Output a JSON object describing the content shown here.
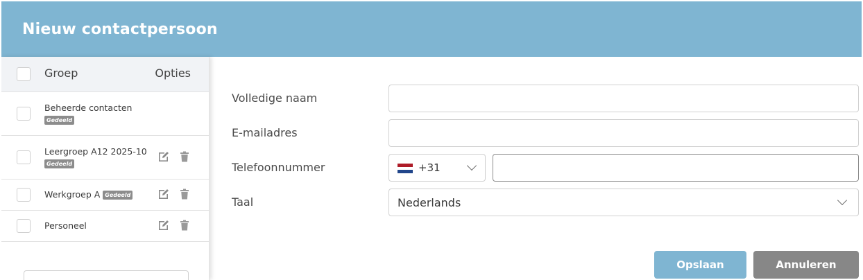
{
  "header": {
    "title": "Nieuw contactpersoon"
  },
  "groups": {
    "column_group": "Groep",
    "column_options": "Opties",
    "items": [
      {
        "name": "Beheerde contacten",
        "badge": "Gedeeld",
        "editable": false
      },
      {
        "name": "Leergroep A12 2025-10",
        "badge": "Gedeeld",
        "editable": true
      },
      {
        "name": "Werkgroep A",
        "badge": "Gedeeld",
        "editable": true
      },
      {
        "name": "Personeel",
        "badge": "",
        "editable": true
      }
    ]
  },
  "form": {
    "full_name_label": "Volledige naam",
    "full_name_value": "",
    "email_label": "E-mailadres",
    "email_value": "",
    "phone_label": "Telefoonnummer",
    "phone_country_code": "+31",
    "phone_value": "",
    "language_label": "Taal",
    "language_value": "Nederlands"
  },
  "buttons": {
    "save": "Opslaan",
    "cancel": "Annuleren"
  },
  "colors": {
    "header": "#7fb5d2",
    "save_button": "#7fb5d2",
    "cancel_button": "#878787",
    "badge": "#8c8c8c"
  },
  "icons": {
    "edit": "pencil-icon",
    "delete": "trash-icon",
    "flag": "netherlands-flag-icon"
  }
}
